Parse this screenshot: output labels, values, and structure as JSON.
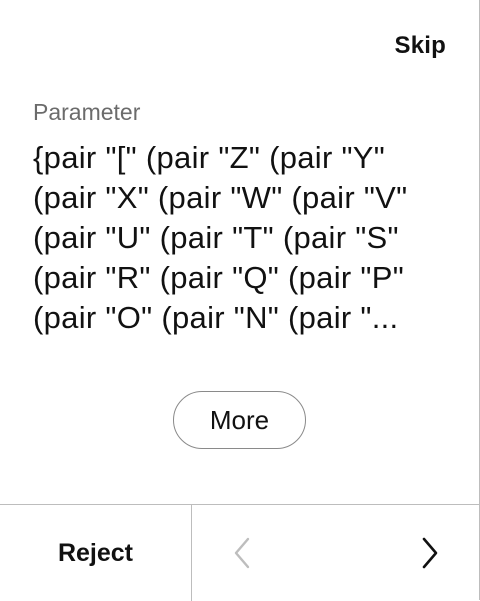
{
  "header": {
    "skip_label": "Skip"
  },
  "main": {
    "parameter_label": "Parameter",
    "parameter_value": "{pair \"[\" (pair \"Z\" (pair \"Y\" (pair \"X\" (pair \"W\" (pair \"V\" (pair \"U\" (pair \"T\" (pair \"S\" (pair \"R\" (pair \"Q\" (pair \"P\" (pair \"O\" (pair \"N\" (pair \"...",
    "more_label": "More"
  },
  "footer": {
    "reject_label": "Reject",
    "prev_icon": "chevron-left-icon",
    "next_icon": "chevron-right-icon",
    "prev_disabled": true
  },
  "colors": {
    "text": "#111111",
    "muted": "#6b6b6b",
    "disabled": "#bdbdbd",
    "border": "#bdbdbd"
  }
}
